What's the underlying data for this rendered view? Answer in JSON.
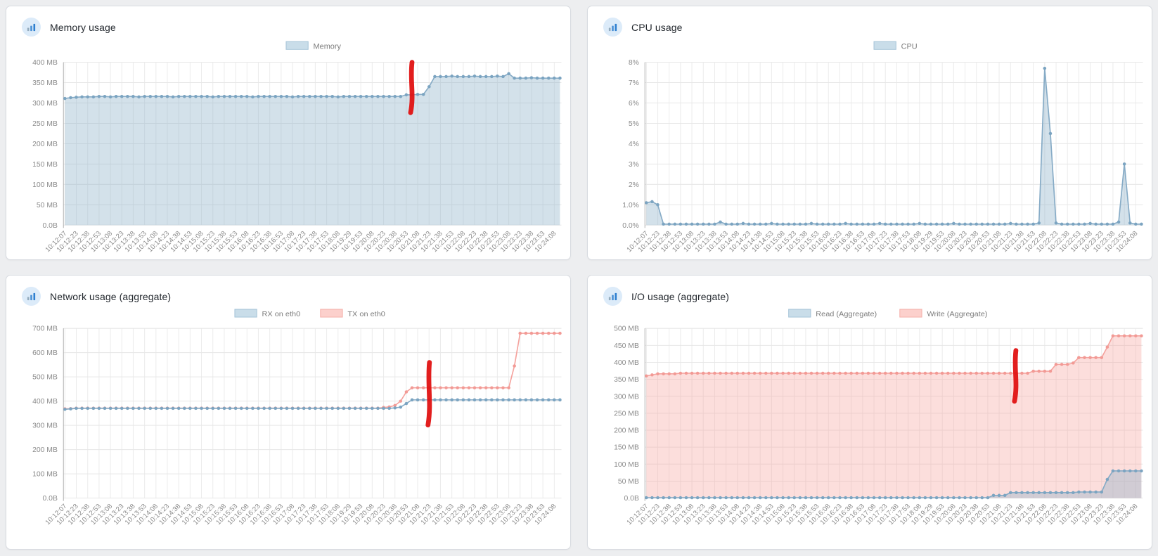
{
  "page": {
    "background": "#edeef0"
  },
  "panels": [
    {
      "title": "Memory usage",
      "icon": "bar-chart-icon"
    },
    {
      "title": "CPU usage",
      "icon": "bar-chart-icon"
    },
    {
      "title": "Network usage (aggregate)",
      "icon": "bar-chart-icon"
    },
    {
      "title": "I/O usage (aggregate)",
      "icon": "bar-chart-icon"
    }
  ],
  "palette": {
    "blue": {
      "line": "#86abc6",
      "dot": "#7ba4c1",
      "fill": "rgba(140,175,200,0.38)",
      "swatch": "#c9dde9",
      "swatch_border": "#a6c4d8"
    },
    "pink": {
      "line": "#f5a39e",
      "dot": "#f29a95",
      "fill": "rgba(246,158,152,0.34)",
      "swatch": "#fcd0cc",
      "swatch_border": "#f5b0aa"
    }
  },
  "x_axis": {
    "shared_by_all_charts": true,
    "samples_per_label": 2,
    "labels": [
      "10:12:07",
      "10:12:23",
      "10:12:38",
      "10:12:53",
      "10:13:08",
      "10:13:23",
      "10:13:38",
      "10:13:53",
      "10:14:08",
      "10:14:23",
      "10:14:38",
      "10:14:53",
      "10:15:08",
      "10:15:23",
      "10:15:38",
      "10:15:53",
      "10:16:08",
      "10:16:23",
      "10:16:38",
      "10:16:53",
      "10:17:08",
      "10:17:23",
      "10:17:38",
      "10:17:53",
      "10:18:08",
      "10:19:29",
      "10:19:53",
      "10:20:08",
      "10:20:23",
      "10:20:38",
      "10:20:53",
      "10:21:08",
      "10:21:23",
      "10:21:38",
      "10:21:53",
      "10:22:08",
      "10:22:23",
      "10:22:38",
      "10:22:53",
      "10:23:08",
      "10:23:23",
      "10:23:38",
      "10:23:53",
      "10:24:08"
    ]
  },
  "chart_data": [
    {
      "type": "area",
      "title": "Memory usage",
      "ylabel_unit": "MB",
      "ylim": [
        0,
        400
      ],
      "grid": true,
      "legend_position": "top-center",
      "yticks": [
        {
          "v": 400,
          "label": "400 MB"
        },
        {
          "v": 350,
          "label": "350 MB"
        },
        {
          "v": 300,
          "label": "300 MB"
        },
        {
          "v": 250,
          "label": "250 MB"
        },
        {
          "v": 200,
          "label": "200 MB"
        },
        {
          "v": 150,
          "label": "150 MB"
        },
        {
          "v": 100,
          "label": "100 MB"
        },
        {
          "v": 50,
          "label": "50 MB"
        },
        {
          "v": 0,
          "label": "0.0B"
        }
      ],
      "series": [
        {
          "name": "Memory",
          "color": "blue",
          "fill": true,
          "values": [
            311,
            313,
            314,
            315,
            315,
            315,
            316,
            316,
            315,
            316,
            316,
            316,
            316,
            315,
            316,
            316,
            316,
            316,
            316,
            315,
            316,
            316,
            316,
            316,
            316,
            316,
            315,
            316,
            316,
            316,
            316,
            316,
            316,
            315,
            316,
            316,
            316,
            316,
            316,
            316,
            315,
            316,
            316,
            316,
            316,
            316,
            316,
            316,
            315,
            316,
            316,
            316,
            316,
            316,
            316,
            316,
            316,
            316,
            316,
            316,
            320,
            320,
            321,
            321,
            340,
            365,
            365,
            365,
            366,
            365,
            365,
            365,
            366,
            365,
            365,
            365,
            366,
            365,
            372,
            361,
            361,
            361,
            362,
            361,
            361,
            361,
            361,
            361
          ]
        }
      ],
      "red_mark": {
        "x_frac": 0.7,
        "y1_frac": 0.0,
        "y2_frac": 0.31
      }
    },
    {
      "type": "area",
      "title": "CPU usage",
      "ylabel_unit": "%",
      "ylim": [
        0,
        8
      ],
      "grid": true,
      "legend_position": "top-center",
      "yticks": [
        {
          "v": 8,
          "label": "8%"
        },
        {
          "v": 7,
          "label": "7%"
        },
        {
          "v": 6,
          "label": "6%"
        },
        {
          "v": 5,
          "label": "5%"
        },
        {
          "v": 4,
          "label": "4%"
        },
        {
          "v": 3,
          "label": "3%"
        },
        {
          "v": 2,
          "label": "2%"
        },
        {
          "v": 1,
          "label": "1.0%"
        },
        {
          "v": 0,
          "label": "0.0%"
        }
      ],
      "series": [
        {
          "name": "CPU",
          "color": "blue",
          "fill": true,
          "values": [
            1.1,
            1.15,
            1.0,
            0.05,
            0.05,
            0.05,
            0.05,
            0.05,
            0.05,
            0.05,
            0.05,
            0.05,
            0.05,
            0.15,
            0.05,
            0.05,
            0.05,
            0.08,
            0.05,
            0.05,
            0.05,
            0.05,
            0.08,
            0.05,
            0.05,
            0.05,
            0.05,
            0.05,
            0.05,
            0.08,
            0.05,
            0.05,
            0.05,
            0.05,
            0.05,
            0.08,
            0.05,
            0.05,
            0.05,
            0.05,
            0.05,
            0.08,
            0.05,
            0.05,
            0.05,
            0.05,
            0.05,
            0.05,
            0.08,
            0.05,
            0.05,
            0.05,
            0.05,
            0.05,
            0.08,
            0.05,
            0.05,
            0.05,
            0.05,
            0.05,
            0.05,
            0.05,
            0.05,
            0.05,
            0.08,
            0.05,
            0.05,
            0.05,
            0.05,
            0.1,
            7.7,
            4.5,
            0.1,
            0.05,
            0.05,
            0.05,
            0.05,
            0.05,
            0.08,
            0.05,
            0.05,
            0.05,
            0.05,
            0.15,
            3.0,
            0.1,
            0.05,
            0.05
          ]
        }
      ],
      "red_mark": null
    },
    {
      "type": "line",
      "title": "Network usage (aggregate)",
      "ylabel_unit": "MB",
      "ylim": [
        0,
        700
      ],
      "grid": true,
      "legend_position": "top-center",
      "yticks": [
        {
          "v": 700,
          "label": "700 MB"
        },
        {
          "v": 600,
          "label": "600 MB"
        },
        {
          "v": 500,
          "label": "500 MB"
        },
        {
          "v": 400,
          "label": "400 MB"
        },
        {
          "v": 300,
          "label": "300 MB"
        },
        {
          "v": 200,
          "label": "200 MB"
        },
        {
          "v": 100,
          "label": "100 MB"
        },
        {
          "v": 0,
          "label": "0.0B"
        }
      ],
      "series": [
        {
          "name": "RX on eth0",
          "color": "blue",
          "fill": false,
          "values": [
            366,
            368,
            370,
            370,
            370,
            370,
            370,
            370,
            370,
            370,
            370,
            370,
            370,
            370,
            370,
            370,
            370,
            370,
            370,
            370,
            370,
            370,
            370,
            370,
            370,
            370,
            370,
            370,
            370,
            370,
            370,
            370,
            370,
            370,
            370,
            370,
            370,
            370,
            370,
            370,
            370,
            370,
            370,
            370,
            370,
            370,
            370,
            370,
            370,
            370,
            370,
            370,
            370,
            370,
            370,
            370,
            370,
            370,
            372,
            375,
            390,
            405,
            405,
            405,
            405,
            405,
            405,
            405,
            405,
            405,
            405,
            405,
            405,
            405,
            405,
            405,
            405,
            405,
            405,
            405,
            405,
            405,
            405,
            405,
            405,
            405,
            405,
            405
          ]
        },
        {
          "name": "TX on eth0",
          "color": "pink",
          "fill": false,
          "values": [
            368,
            369,
            371,
            371,
            371,
            371,
            371,
            371,
            371,
            371,
            371,
            371,
            371,
            371,
            371,
            371,
            371,
            371,
            371,
            371,
            371,
            371,
            371,
            371,
            371,
            371,
            371,
            371,
            371,
            371,
            371,
            371,
            371,
            371,
            371,
            371,
            371,
            371,
            371,
            371,
            371,
            371,
            371,
            371,
            371,
            371,
            371,
            371,
            371,
            371,
            371,
            371,
            371,
            371,
            371,
            371,
            374,
            376,
            382,
            400,
            438,
            455,
            455,
            455,
            455,
            455,
            455,
            455,
            455,
            455,
            455,
            455,
            455,
            455,
            455,
            455,
            455,
            455,
            455,
            545,
            680,
            680,
            680,
            680,
            680,
            680,
            680,
            680
          ]
        }
      ],
      "red_mark": {
        "x_frac": 0.735,
        "y1_frac": 0.2,
        "y2_frac": 0.57
      }
    },
    {
      "type": "area",
      "title": "I/O usage (aggregate)",
      "ylabel_unit": "MB",
      "ylim": [
        0,
        500
      ],
      "grid": true,
      "legend_position": "top-center",
      "yticks": [
        {
          "v": 500,
          "label": "500 MB"
        },
        {
          "v": 450,
          "label": "450 MB"
        },
        {
          "v": 400,
          "label": "400 MB"
        },
        {
          "v": 350,
          "label": "350 MB"
        },
        {
          "v": 300,
          "label": "300 MB"
        },
        {
          "v": 250,
          "label": "250 MB"
        },
        {
          "v": 200,
          "label": "200 MB"
        },
        {
          "v": 150,
          "label": "150 MB"
        },
        {
          "v": 100,
          "label": "100 MB"
        },
        {
          "v": 50,
          "label": "50 MB"
        },
        {
          "v": 0,
          "label": "0.0B"
        }
      ],
      "series": [
        {
          "name": "Read (Aggregate)",
          "color": "blue",
          "fill": true,
          "values": [
            1,
            1,
            1,
            1,
            1,
            1,
            1,
            1,
            1,
            1,
            1,
            1,
            1,
            1,
            1,
            1,
            1,
            1,
            1,
            1,
            1,
            1,
            1,
            1,
            1,
            1,
            1,
            1,
            1,
            1,
            1,
            1,
            1,
            1,
            1,
            1,
            1,
            1,
            1,
            1,
            1,
            1,
            1,
            1,
            1,
            1,
            1,
            1,
            1,
            1,
            1,
            1,
            1,
            1,
            1,
            1,
            1,
            1,
            1,
            1,
            1,
            8,
            8,
            8,
            16,
            16,
            16,
            16,
            16,
            16,
            16,
            16,
            16,
            16,
            16,
            16,
            18,
            18,
            18,
            18,
            18,
            55,
            80,
            80,
            80,
            80,
            80,
            80
          ]
        },
        {
          "name": "Write (Aggregate)",
          "color": "pink",
          "fill": true,
          "values": [
            360,
            363,
            366,
            366,
            366,
            366,
            368,
            368,
            368,
            368,
            368,
            368,
            368,
            368,
            368,
            368,
            368,
            368,
            368,
            368,
            368,
            368,
            368,
            368,
            368,
            368,
            368,
            368,
            368,
            368,
            368,
            368,
            368,
            368,
            368,
            368,
            368,
            368,
            368,
            368,
            368,
            368,
            368,
            368,
            368,
            368,
            368,
            368,
            368,
            368,
            368,
            368,
            368,
            368,
            368,
            368,
            368,
            368,
            368,
            368,
            368,
            368,
            368,
            368,
            368,
            368,
            368,
            368,
            374,
            374,
            374,
            374,
            394,
            394,
            394,
            398,
            414,
            414,
            414,
            414,
            414,
            445,
            478,
            478,
            478,
            478,
            478,
            478
          ]
        }
      ],
      "red_mark": {
        "x_frac": 0.745,
        "y1_frac": 0.13,
        "y2_frac": 0.43
      }
    }
  ]
}
